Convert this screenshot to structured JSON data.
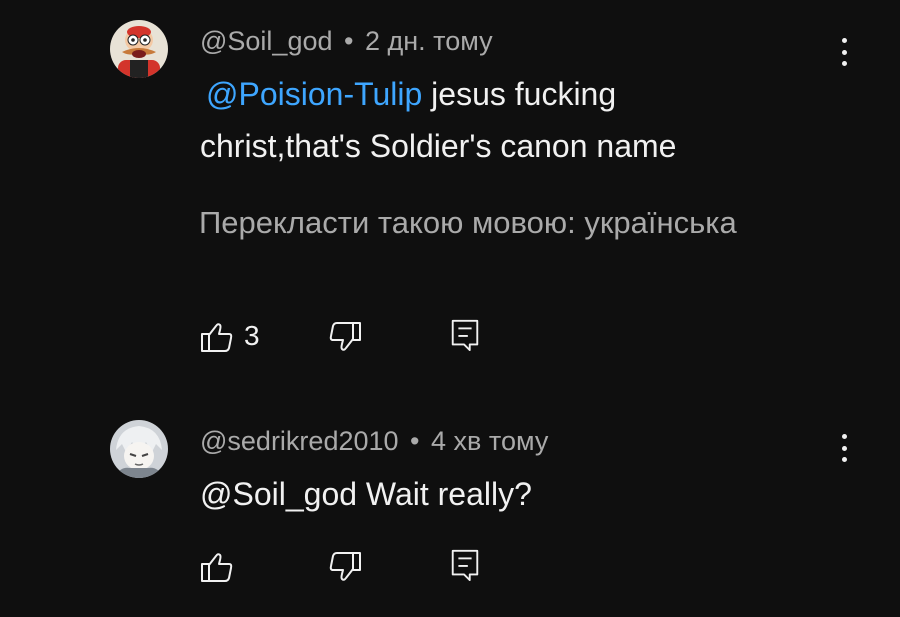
{
  "comments": [
    {
      "author": "@Soil_god",
      "separator": "•",
      "time": "2 дн. тому",
      "mention": "@Poision-Tulip",
      "text_after_mention": " jesus fucking christ,that's Soldier's canon name",
      "translate_label": "Перекласти такою мовою: українська",
      "like_count": "3",
      "avatar_icon": "cartoon-character-avatar",
      "colors": {
        "avatar_bg": "#e8e2d6"
      }
    },
    {
      "author": "@sedrikred2010",
      "separator": "•",
      "time": "4 хв тому",
      "text": "@Soil_god Wait really?",
      "avatar_icon": "anime-character-avatar",
      "colors": {
        "avatar_bg": "#cfd3d8"
      }
    }
  ],
  "icons": {
    "like": "thumbs-up-icon",
    "dislike": "thumbs-down-icon",
    "reply": "reply-icon",
    "menu": "more-vert-icon"
  },
  "colors": {
    "background": "#0f0f0f",
    "text": "#f1f1f1",
    "secondary": "#aaaaaa",
    "mention": "#3ea6ff"
  }
}
